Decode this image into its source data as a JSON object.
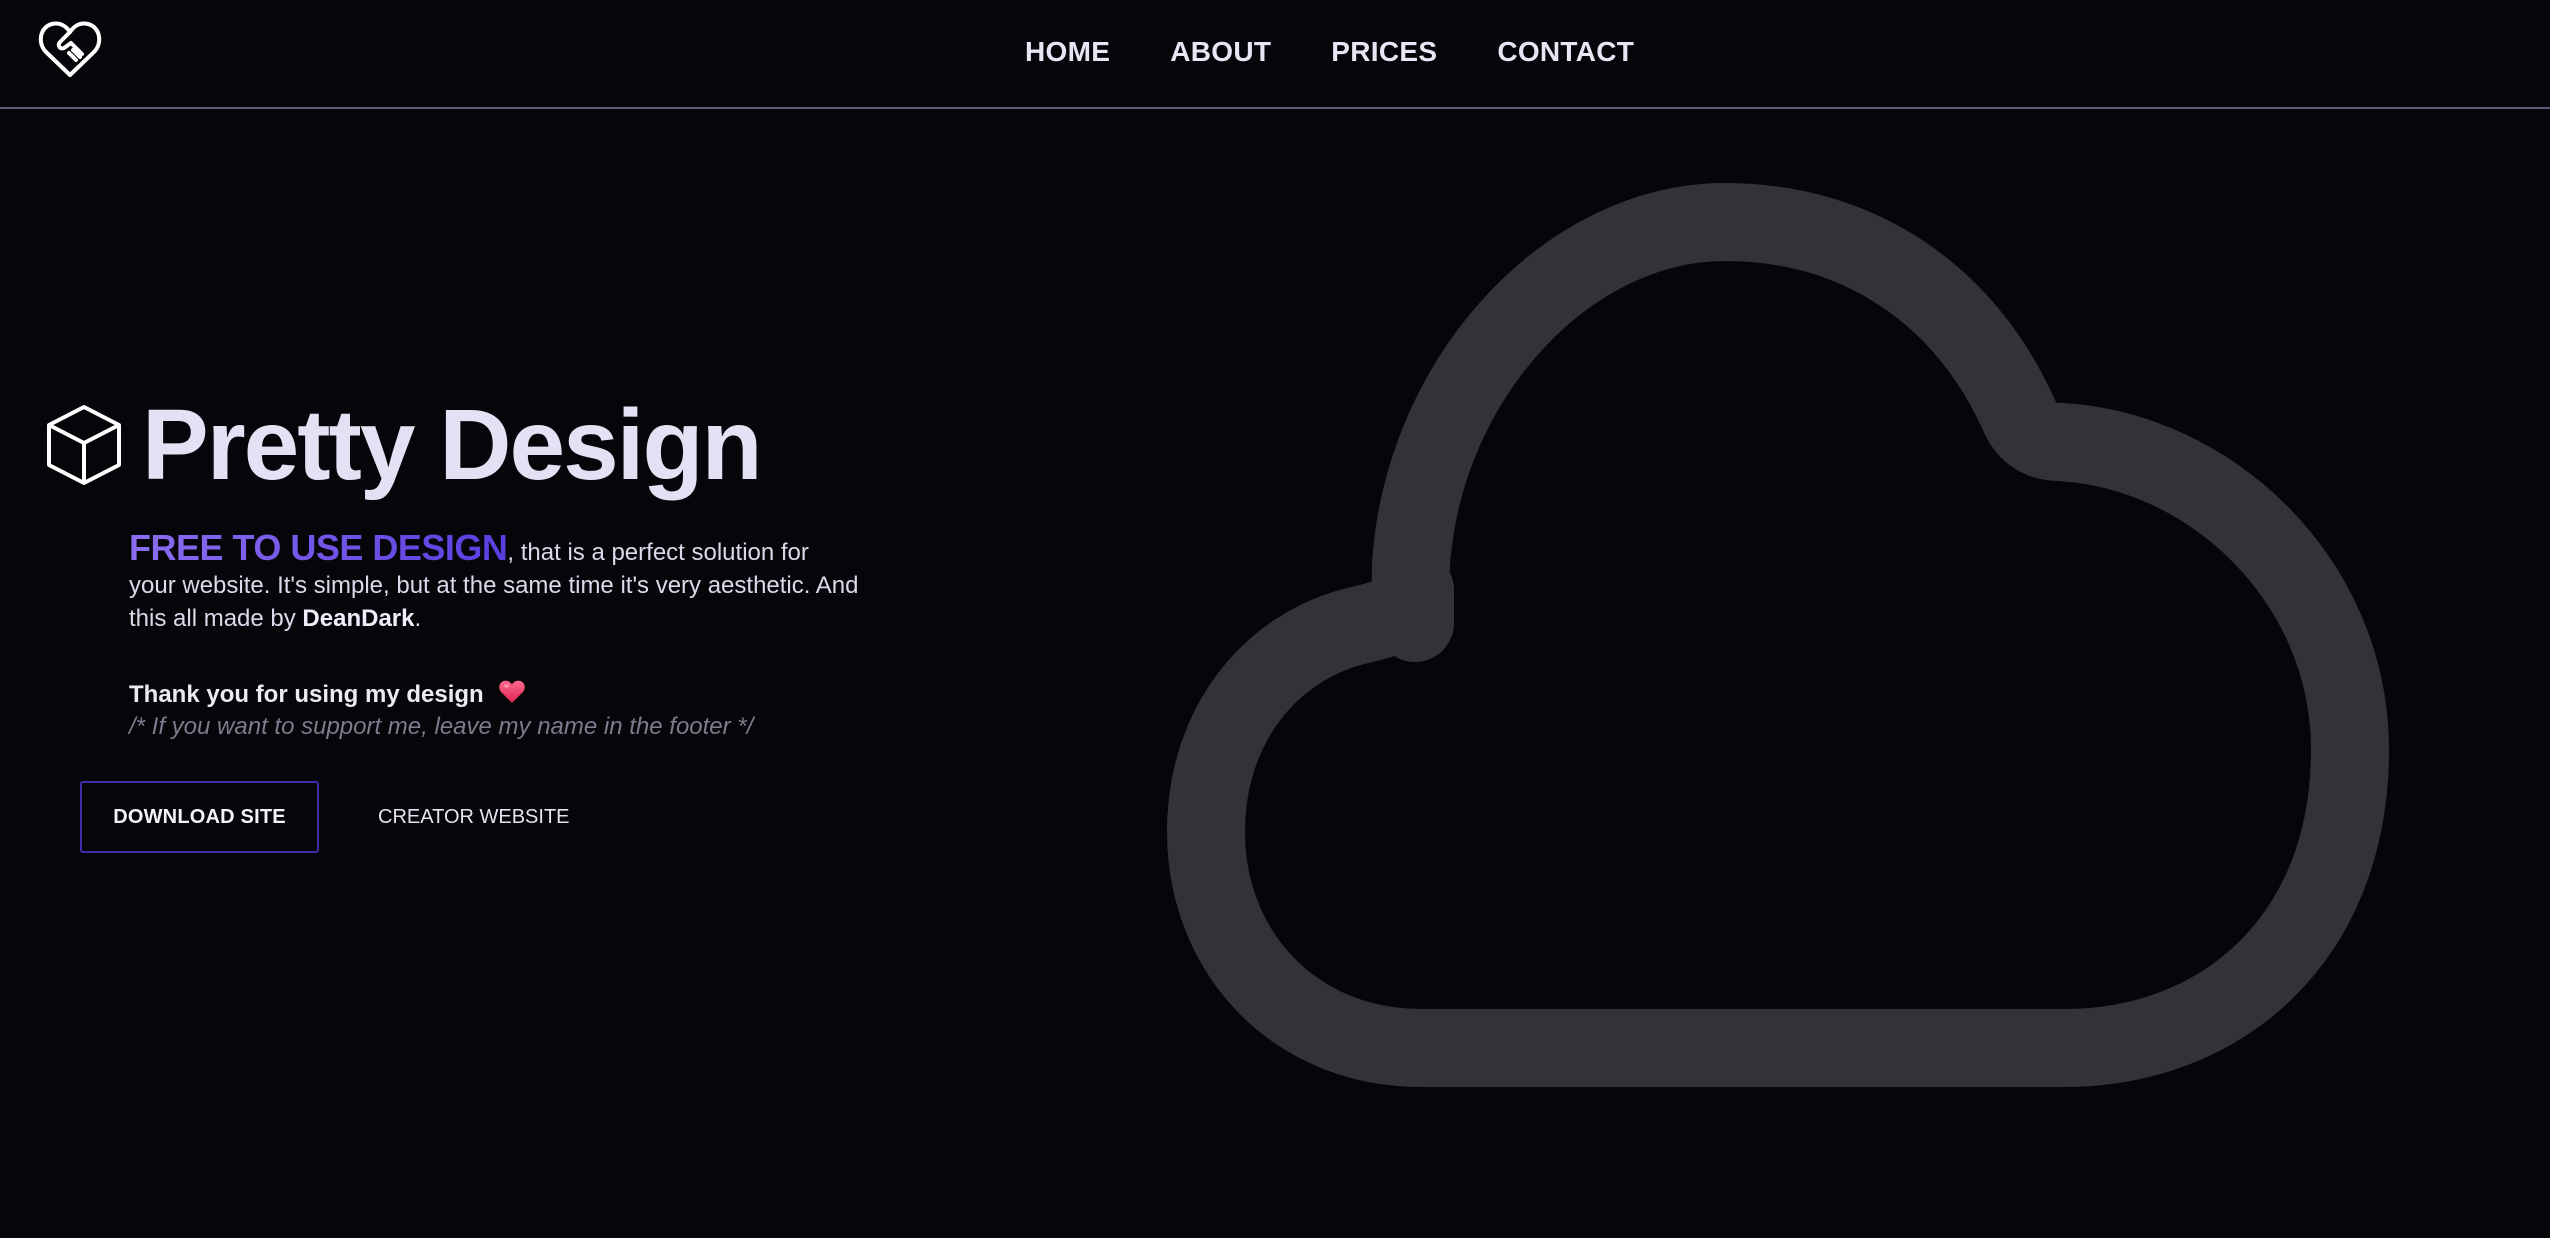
{
  "header": {
    "logo_icon": "heart-handshake-icon",
    "nav": [
      {
        "label": "HOME"
      },
      {
        "label": "ABOUT"
      },
      {
        "label": "PRICES"
      },
      {
        "label": "CONTACT"
      }
    ]
  },
  "hero": {
    "title_icon": "cube-icon",
    "title": "Pretty Design",
    "highlight": "FREE TO USE DESIGN",
    "intro_text": ", that is a perfect solution for your website. It's simple, but at the same time it's very aesthetic. And this all made by ",
    "author": "DeanDark",
    "intro_end": ".",
    "thanks": "Thank you for using my design",
    "thanks_icon": "heart-icon",
    "support_note": "/* If you want to support me, leave my name in the footer */",
    "download_button": "DOWNLOAD SITE",
    "creator_link": "CREATOR WEBSITE",
    "illustration_icon": "cloud-icon"
  },
  "colors": {
    "background": "#06050a",
    "accent": "#6c4fe8",
    "heart": "#f0456e",
    "cloud": "#333239"
  }
}
